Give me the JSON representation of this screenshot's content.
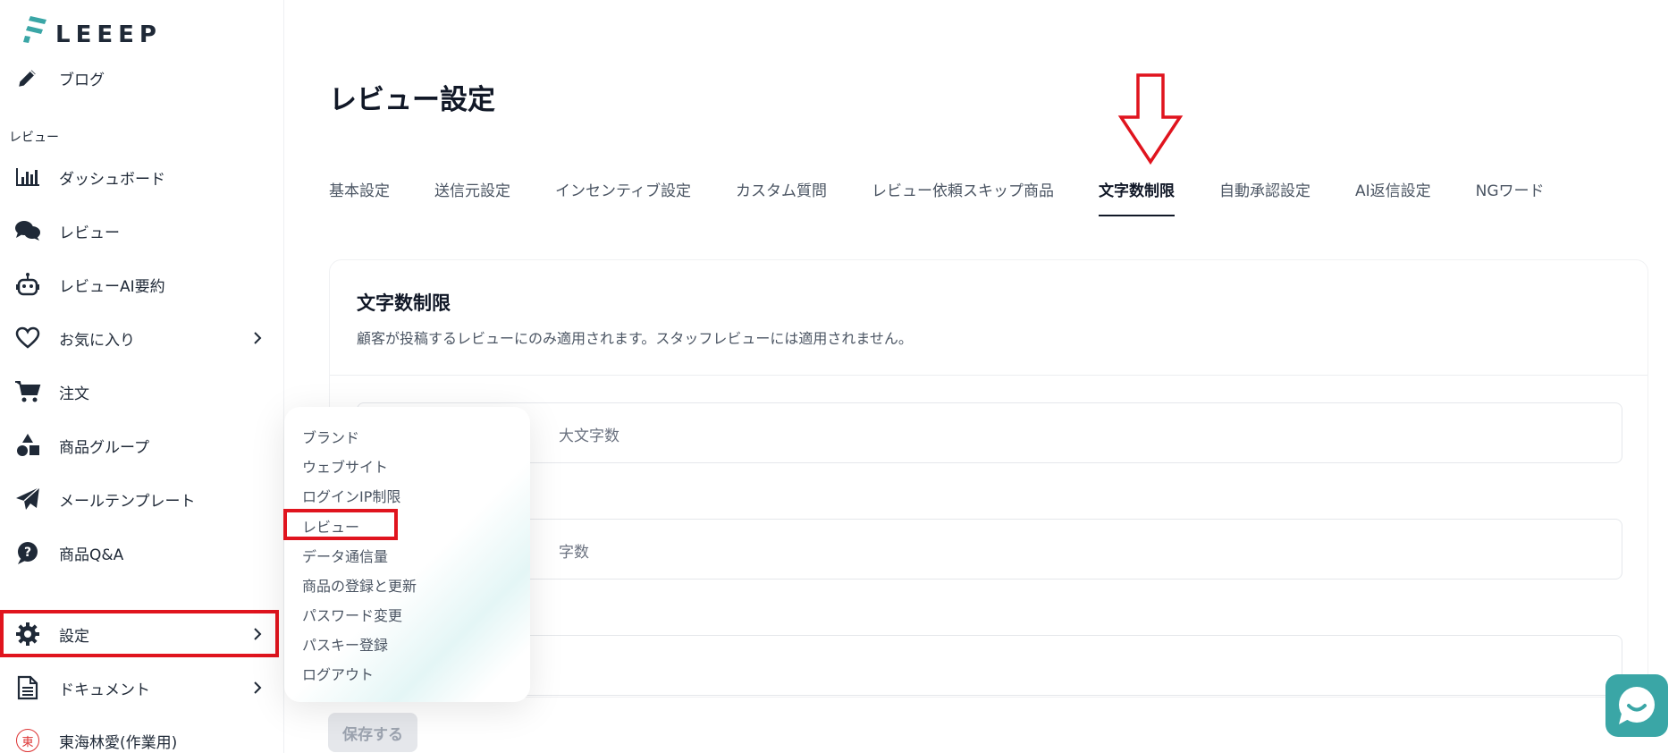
{
  "brand": {
    "name": "LEEEP",
    "accent": "#3aa6a6"
  },
  "sidebar": {
    "blog": "ブログ",
    "section_review": "レビュー",
    "items": [
      {
        "label": "ダッシュボード",
        "icon": "bar-chart-icon"
      },
      {
        "label": "レビュー",
        "icon": "chat-bubbles-icon"
      },
      {
        "label": "レビューAI要約",
        "icon": "robot-icon"
      },
      {
        "label": "お気に入り",
        "icon": "heart-icon"
      },
      {
        "label": "注文",
        "icon": "cart-icon"
      },
      {
        "label": "商品グループ",
        "icon": "shapes-icon"
      },
      {
        "label": "メールテンプレート",
        "icon": "paper-plane-icon"
      },
      {
        "label": "商品Q&A",
        "icon": "question-bubble-icon"
      }
    ],
    "settings": "設定",
    "documents": "ドキュメント",
    "user": {
      "avatar": "東",
      "name": "東海林愛(作業用)"
    }
  },
  "page": {
    "title": "レビュー設定"
  },
  "tabs": [
    "基本設定",
    "送信元設定",
    "インセンティブ設定",
    "カスタム質問",
    "レビュー依頼スキップ商品",
    "文字数制限",
    "自動承認設定",
    "AI返信設定",
    "NGワード"
  ],
  "active_tab": "文字数制限",
  "card": {
    "title": "文字数制限",
    "description": "顧客が投稿するレビューにのみ適用されます。スタッフレビューには適用されません。",
    "field1_label": "大文字数",
    "field2_label": "字数"
  },
  "save_button": "保存する",
  "dropdown": [
    "ブランド",
    "ウェブサイト",
    "ログインIP制限",
    "レビュー",
    "データ通信量",
    "商品の登録と更新",
    "パスワード変更",
    "パスキー登録",
    "ログアウト"
  ],
  "highlight_color": "#e0141e"
}
